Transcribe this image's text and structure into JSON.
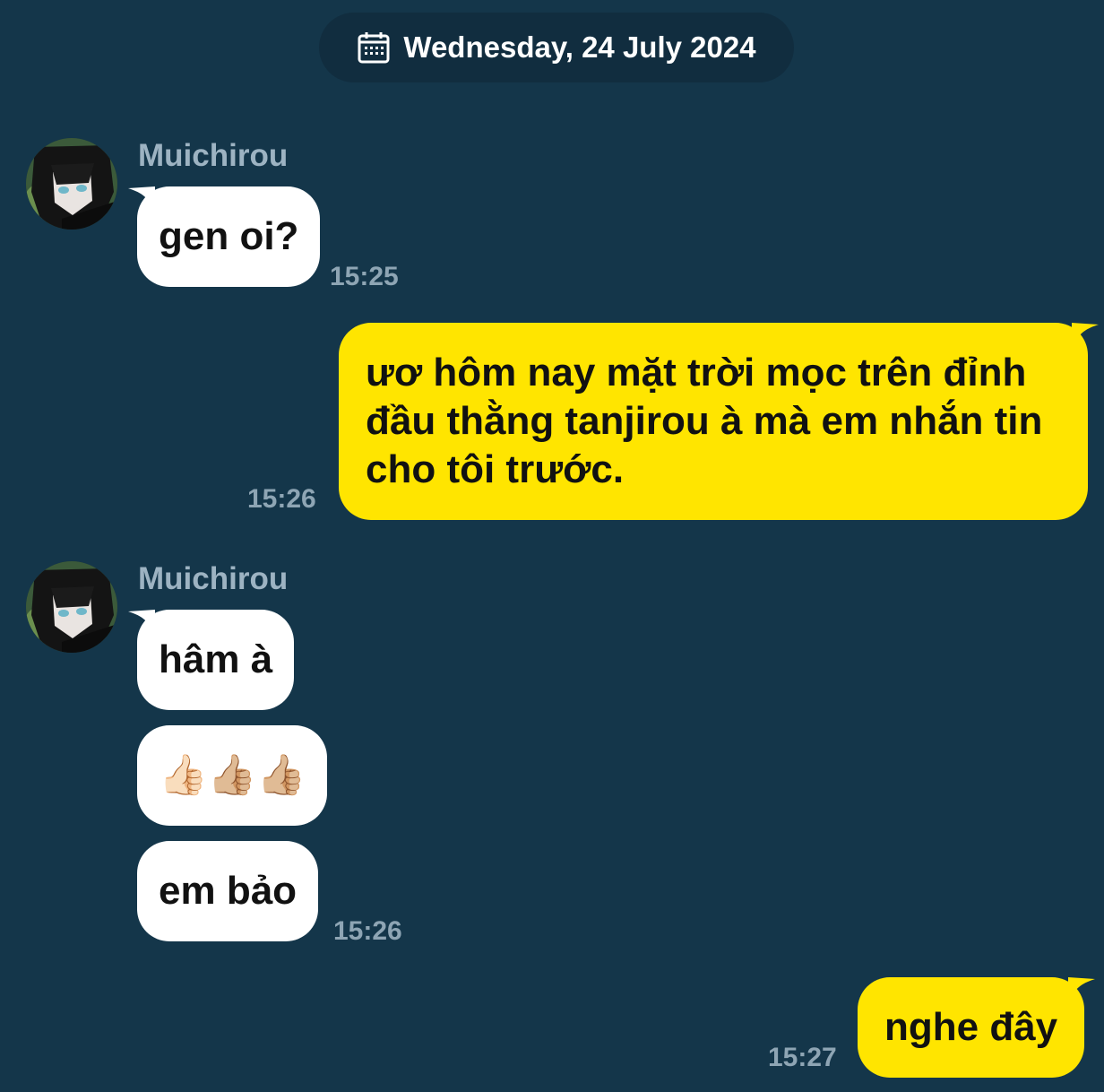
{
  "date_header": {
    "icon": "calendar-icon",
    "label": "Wednesday, 24 July 2024"
  },
  "messages": [
    {
      "sender": "Muichirou",
      "bubbles": [
        "gen oi?"
      ],
      "time": "15:25"
    },
    {
      "sender": "me",
      "bubbles": [
        "ươ hôm nay mặt trời mọc trên đỉnh đầu thằng tanjirou à mà em nhắn tin cho tôi trước."
      ],
      "time": "15:26"
    },
    {
      "sender": "Muichirou",
      "bubbles": [
        "hâm à",
        "👍🏻👍🏼👍🏼",
        "em bảo"
      ],
      "time": "15:26"
    },
    {
      "sender": "me",
      "bubbles": [
        "nghe đây"
      ],
      "time": "15:27"
    }
  ],
  "colors": {
    "background": "#14364a",
    "incoming_bubble": "#ffffff",
    "outgoing_bubble": "#ffe500",
    "date_pill": "#112d3f",
    "sender_name": "#9db3c2",
    "timestamp": "#8ea5b4"
  }
}
